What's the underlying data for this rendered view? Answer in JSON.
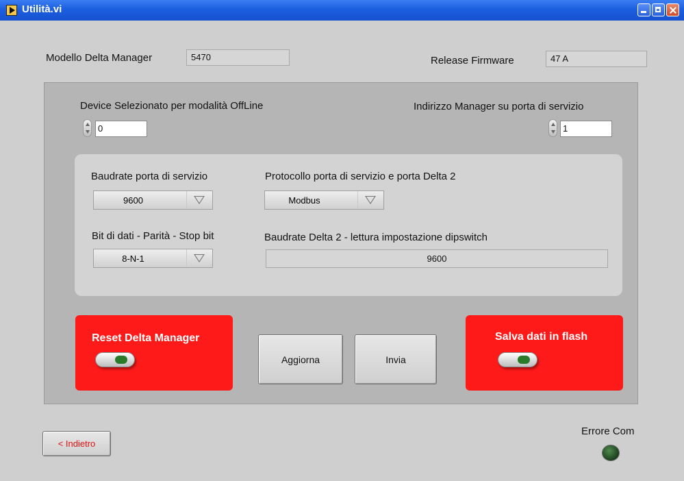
{
  "window": {
    "title": "Utilità.vi"
  },
  "header": {
    "model_label": "Modello Delta Manager",
    "model_value": "5470",
    "firmware_label": "Release Firmware",
    "firmware_value": "47  A"
  },
  "device": {
    "offline_label": "Device Selezionato per modalità OffLine",
    "offline_value": "0",
    "address_label": "Indirizzo Manager su porta di servizio",
    "address_value": "1"
  },
  "settings": {
    "baud_label": "Baudrate porta di servizio",
    "baud_value": "9600",
    "protocol_label": "Protocollo porta di servizio e porta Delta 2",
    "protocol_value": "Modbus",
    "bits_label": "Bit di dati - Parità - Stop bit",
    "bits_value": "8-N-1",
    "delta2_label": "Baudrate Delta 2 - lettura impostazione dipswitch",
    "delta2_value": "9600"
  },
  "actions": {
    "reset_label": "Reset Delta Manager",
    "update_label": "Aggiorna",
    "send_label": "Invia",
    "save_label": "Salva dati in flash"
  },
  "footer": {
    "back_label": "< Indietro",
    "error_label": "Errore Com"
  },
  "colors": {
    "titlebar": "#1c5fe0",
    "panel": "#b5b5b5",
    "action_red": "#ff1a1a",
    "led_off": "#1c3f1c"
  }
}
